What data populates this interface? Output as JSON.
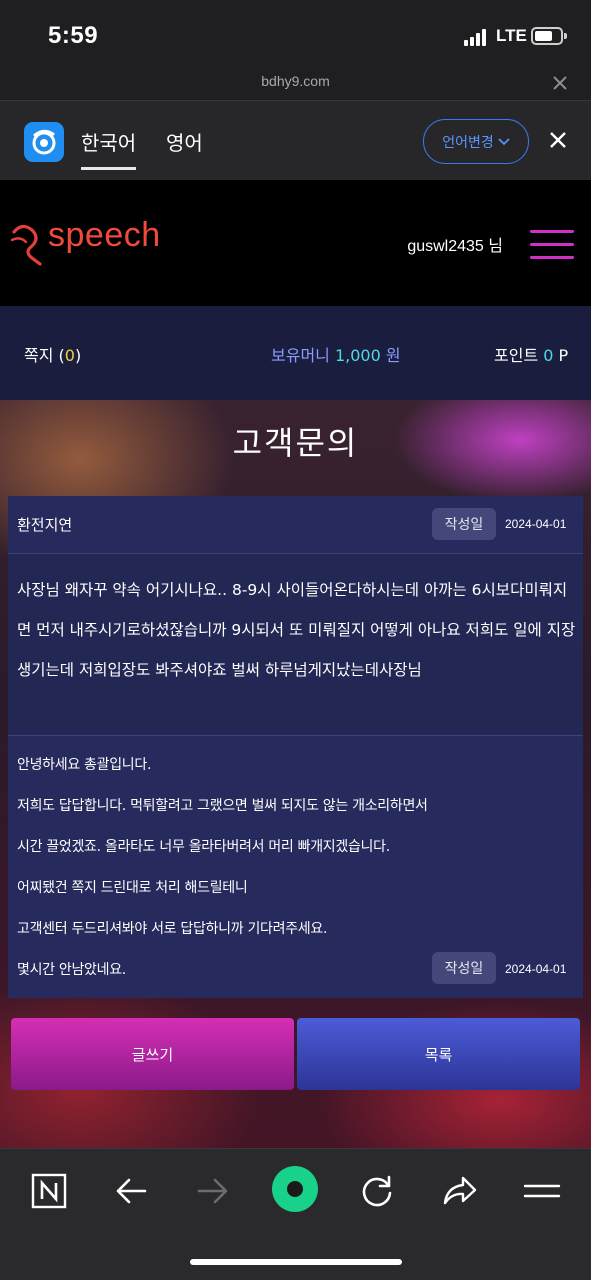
{
  "status_bar": {
    "time": "5:59",
    "network": "LTE"
  },
  "browser": {
    "url": "bdhy9.com",
    "translate": {
      "tabs": [
        {
          "label": "한국어",
          "active": true
        },
        {
          "label": "영어",
          "active": false
        }
      ],
      "change_language_label": "언어변경"
    }
  },
  "site": {
    "logo_text": "speech",
    "username": "guswl2435 님",
    "info": {
      "messages_label": "쪽지",
      "messages_count": "0",
      "balance_label": "보유머니",
      "balance_value": "1,000",
      "balance_unit": "원",
      "points_label": "포인트",
      "points_value": "0",
      "points_unit": "P"
    },
    "page_title": "고객문의"
  },
  "inquiry": {
    "author": "환전지연",
    "written_label": "작성일",
    "date": "2024-04-01",
    "question": "사장님 왜자꾸 약속 어기시나요.. 8-9시 사이들어온다하시는데 아까는 6시보다미뤄지면 먼저 내주시기로하셨잖습니까 9시되서 또 미뤄질지 어떻게 아나요 저희도 일에 지장생기는데 저희입장도 봐주셔야죠 벌써 하루넘게지났는데사장님"
  },
  "answer": {
    "lines": [
      "안녕하세요 총괄입니다.",
      "저희도 답답합니다. 먹튀할려고 그랬으면 벌써 되지도 않는 개소리하면서",
      "시간 끌었겠죠. 올라타도 너무 올라타버려서 머리 빠개지겠습니다.",
      "어찌됐건 쪽지 드린대로 처리 해드릴테니",
      "고객센터 두드리셔봐야 서로 답답하니까 기다려주세요.",
      "몇시간 안남았네요."
    ],
    "written_label": "작성일",
    "date": "2024-04-01"
  },
  "buttons": {
    "write": "글쓰기",
    "list": "목록"
  },
  "icons": [
    "naver-n-icon",
    "back-arrow-icon",
    "forward-arrow-icon",
    "home-circle-icon",
    "refresh-icon",
    "share-icon",
    "menu-lines-icon"
  ],
  "colors": {
    "accent_magenta": "#d12fc7",
    "logo_red": "#ef4a3c",
    "panel_navy": "#262a5c",
    "link_blue": "#3a7af0"
  }
}
